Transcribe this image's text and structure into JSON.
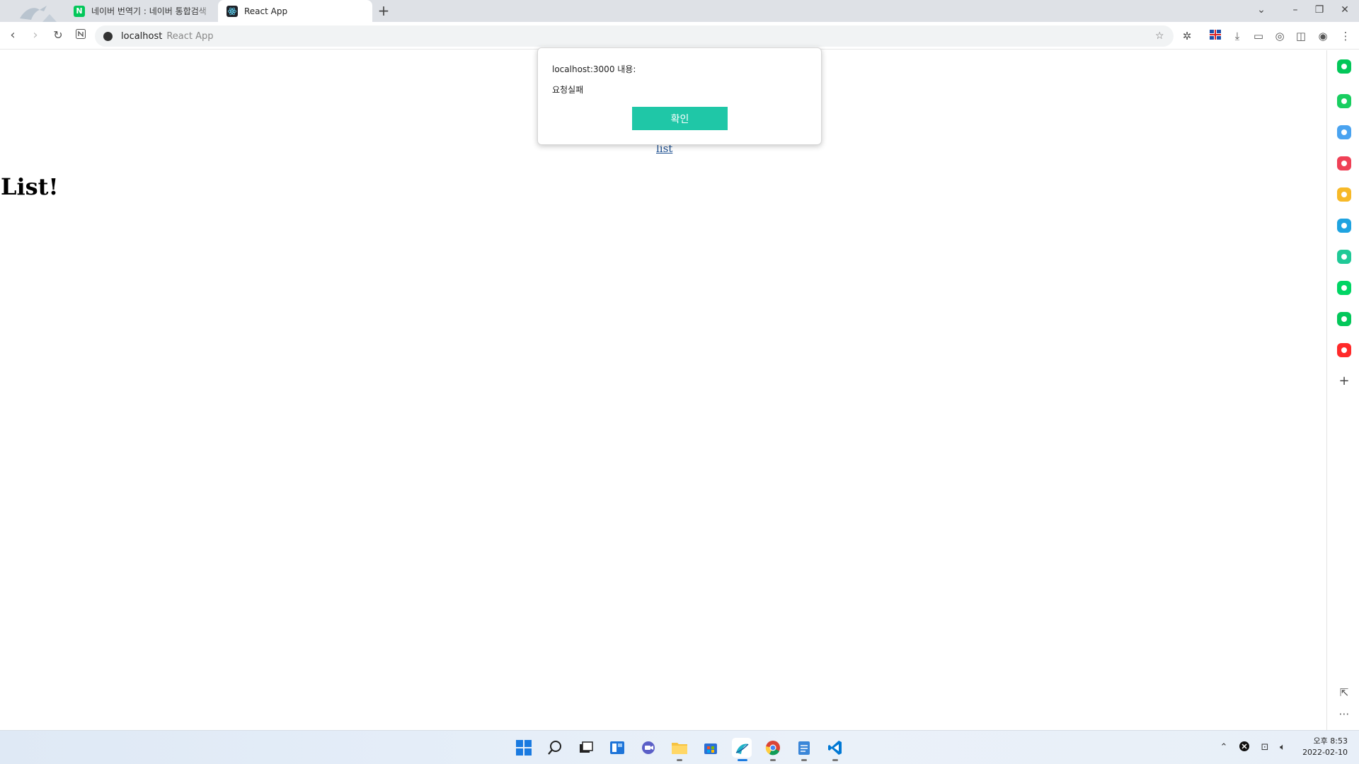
{
  "browser": {
    "tabs": [
      {
        "title": "네이버 번역기 : 네이버 통합검색",
        "favicon": "naver-icon",
        "active": false
      },
      {
        "title": "React App",
        "favicon": "react-icon",
        "active": true
      }
    ],
    "address": {
      "host": "localhost",
      "page_title": "React App"
    }
  },
  "page": {
    "heading": "List!",
    "link_text": "list"
  },
  "dialog": {
    "origin": "localhost:3000 내용:",
    "message": "요청실패",
    "ok_label": "확인",
    "accent": "#1fc7a7"
  },
  "sidebar": {
    "apps": [
      {
        "name": "naver-green-icon",
        "color": "#03c75a"
      },
      {
        "name": "talk-icon",
        "color": "#19ce60"
      },
      {
        "name": "calendar-icon",
        "color": "#4aa3f0"
      },
      {
        "name": "pocket-icon",
        "color": "#ef4056"
      },
      {
        "name": "bookmark-star-icon",
        "color": "#f7b928"
      },
      {
        "name": "papago-icon",
        "color": "#1fa3e0"
      },
      {
        "name": "play-icon",
        "color": "#20c997"
      },
      {
        "name": "webtoon-icon",
        "color": "#00d564"
      },
      {
        "name": "memo-icon",
        "color": "#03c75a"
      },
      {
        "name": "now-icon",
        "color": "#ff2a2a"
      }
    ]
  },
  "taskbar": {
    "clock": {
      "time": "오후 8:53",
      "date": "2022-02-10"
    }
  }
}
